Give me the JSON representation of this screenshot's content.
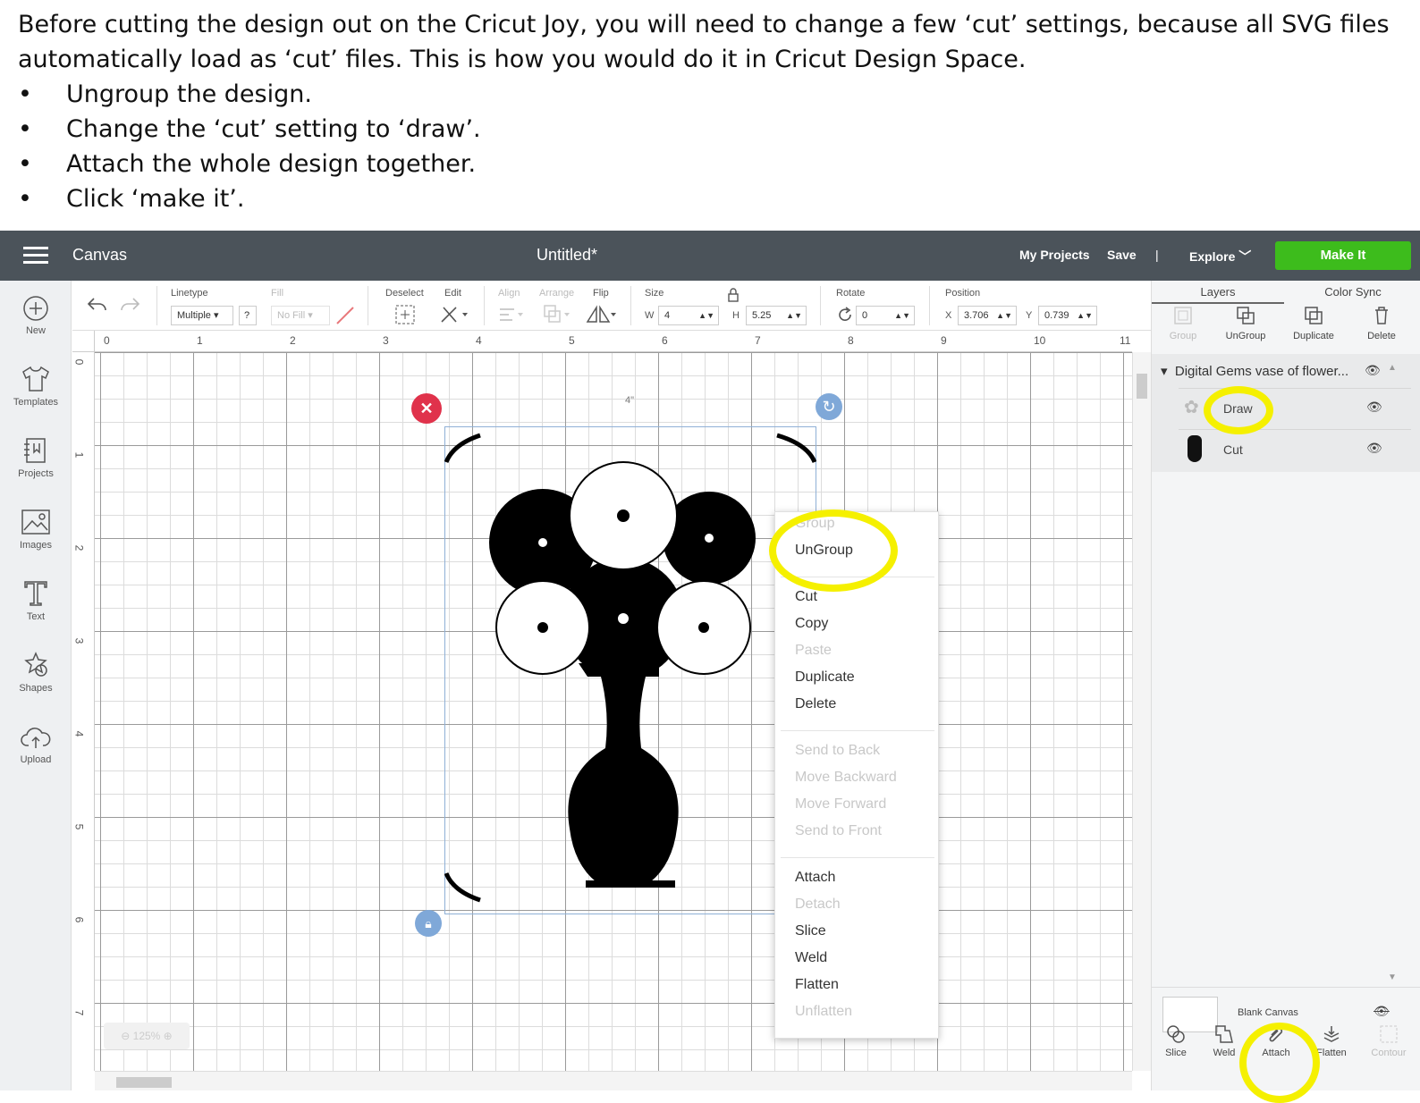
{
  "instructions": {
    "intro": "Before cutting the design out on the Cricut Joy, you will need to change a few ‘cut’ settings, because all SVG files automatically load as ‘cut’ files. This is how you would do it in Cricut Design Space.",
    "bullet_char": "•",
    "steps": [
      "Ungroup the design.",
      "Change the ‘cut’ setting to ‘draw’.",
      "Attach the whole design together.",
      "Click ‘make it’."
    ]
  },
  "header": {
    "canvas_label": "Canvas",
    "title": "Untitled*",
    "my_projects": "My Projects",
    "save": "Save",
    "separator": "|",
    "explore": "Explore",
    "make_it": "Make It"
  },
  "left_nav": [
    "New",
    "Templates",
    "Projects",
    "Images",
    "Text",
    "Shapes",
    "Upload"
  ],
  "toolbar": {
    "linetype_label": "Linetype",
    "linetype_value": "Multiple",
    "linetype_help": "?",
    "fill_label": "Fill",
    "fill_value": "No Fill",
    "deselect": "Deselect",
    "edit": "Edit",
    "align": "Align",
    "arrange": "Arrange",
    "flip": "Flip",
    "size_label": "Size",
    "w_label": "W",
    "w_value": "4",
    "h_label": "H",
    "h_value": "5.25",
    "rotate_label": "Rotate",
    "rotate_value": "0",
    "position_label": "Position",
    "x_label": "X",
    "x_value": "3.706",
    "y_label": "Y",
    "y_value": "0.739"
  },
  "ruler": {
    "top": [
      "0",
      "1",
      "2",
      "3",
      "4",
      "5",
      "6",
      "7",
      "8",
      "9",
      "10",
      "11"
    ],
    "left": [
      "0",
      "1",
      "2",
      "3",
      "4",
      "5",
      "6",
      "7"
    ]
  },
  "canvas": {
    "width_label": "4\"",
    "zoom": "125%"
  },
  "context_menu": {
    "group": "Group",
    "ungroup": "UnGroup",
    "cut": "Cut",
    "copy": "Copy",
    "paste": "Paste",
    "duplicate": "Duplicate",
    "delete": "Delete",
    "send_back": "Send to Back",
    "move_backward": "Move Backward",
    "move_forward": "Move Forward",
    "send_front": "Send to Front",
    "attach": "Attach",
    "detach": "Detach",
    "slice": "Slice",
    "weld": "Weld",
    "flatten": "Flatten",
    "unflatten": "Unflatten"
  },
  "layers_panel": {
    "tabs": [
      "Layers",
      "Color Sync"
    ],
    "tools": [
      "Group",
      "UnGroup",
      "Duplicate",
      "Delete"
    ],
    "group_name": "Digital Gems vase of flower...",
    "layers": [
      "Draw",
      "Cut"
    ],
    "blank_canvas": "Blank Canvas",
    "bottom_tools": [
      "Slice",
      "Weld",
      "Attach",
      "Flatten",
      "Contour"
    ]
  },
  "colors": {
    "header_bg": "#4b535a",
    "make_it": "#3dbc1c",
    "highlight": "#f5f000",
    "close_red": "#e0324b",
    "handle_blue": "#7fa8d8"
  }
}
